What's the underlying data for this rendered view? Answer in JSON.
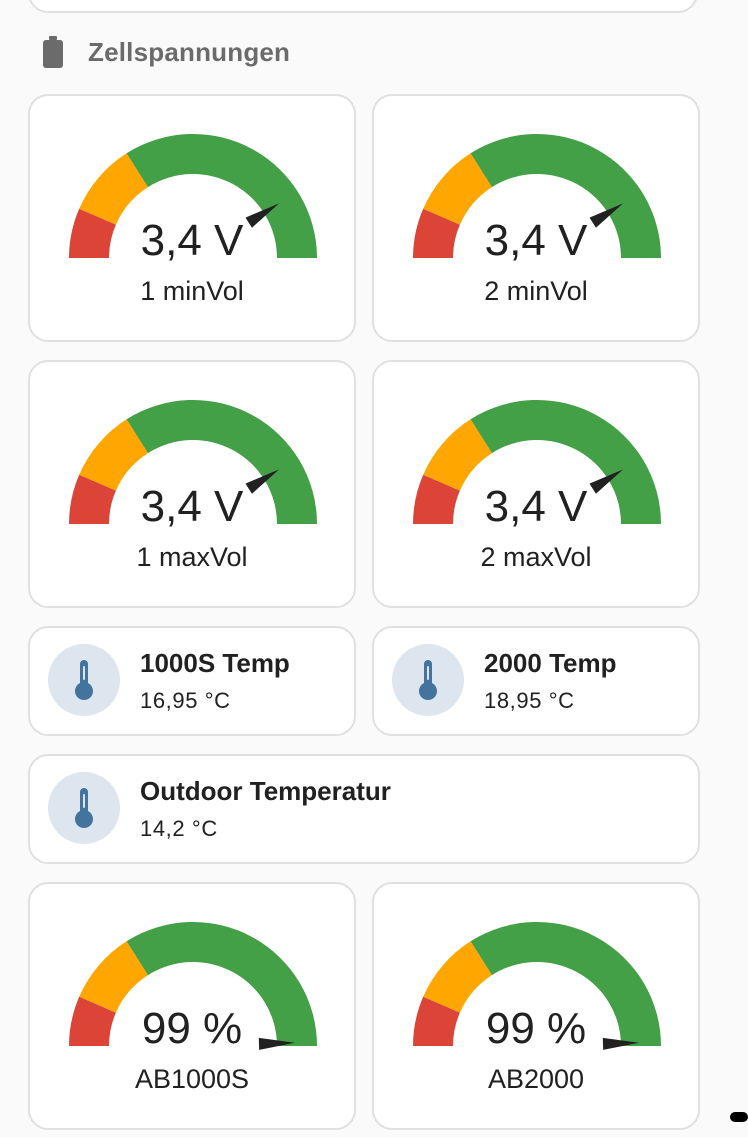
{
  "section": {
    "title": "Zellspannungen",
    "icon": "battery-icon"
  },
  "colors": {
    "red": "#db4437",
    "orange": "#ffa600",
    "green": "#43a047",
    "needle": "#212121",
    "icon": "#44739e",
    "icon_bg": "#dde6ee"
  },
  "voltage_gauges": [
    {
      "value": "3,4 V",
      "name": "1 minVol",
      "level": 0.82
    },
    {
      "value": "3,4 V",
      "name": "2 minVol",
      "level": 0.82
    },
    {
      "value": "3,4 V",
      "name": "1 maxVol",
      "level": 0.82
    },
    {
      "value": "3,4 V",
      "name": "2 maxVol",
      "level": 0.82
    }
  ],
  "temperature_tiles": [
    {
      "name": "1000S Temp",
      "state": "16,95 °C",
      "icon": "thermometer-icon"
    },
    {
      "name": "2000 Temp",
      "state": "18,95 °C",
      "icon": "thermometer-icon"
    },
    {
      "name": "Outdoor Temperatur",
      "state": "14,2 °C",
      "icon": "thermometer-icon"
    }
  ],
  "battery_gauges": [
    {
      "value": "99 %",
      "name": "AB1000S",
      "level": 0.99
    },
    {
      "value": "99 %",
      "name": "AB2000",
      "level": 0.99
    }
  ]
}
